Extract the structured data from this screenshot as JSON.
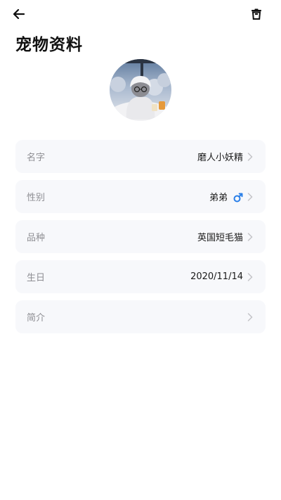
{
  "header": {
    "back_icon": "arrow-left-icon",
    "delete_icon": "trash-icon",
    "title": "宠物资料"
  },
  "avatar": {
    "icon": "pet-avatar-photo"
  },
  "rows": [
    {
      "label": "名字",
      "value": "磨人小妖精"
    },
    {
      "label": "性别",
      "value": "弟弟",
      "icon": "male-icon",
      "icon_color": "#2a7fe8"
    },
    {
      "label": "品种",
      "value": "英国短毛猫"
    },
    {
      "label": "生日",
      "value": "2020/11/14"
    },
    {
      "label": "简介",
      "value": ""
    }
  ],
  "colors": {
    "row_bg": "#f7f8fb",
    "label": "#8e8e93",
    "value": "#1a1a1a",
    "chevron": "#c4c4c8",
    "male_accent": "#2a7fe8"
  }
}
